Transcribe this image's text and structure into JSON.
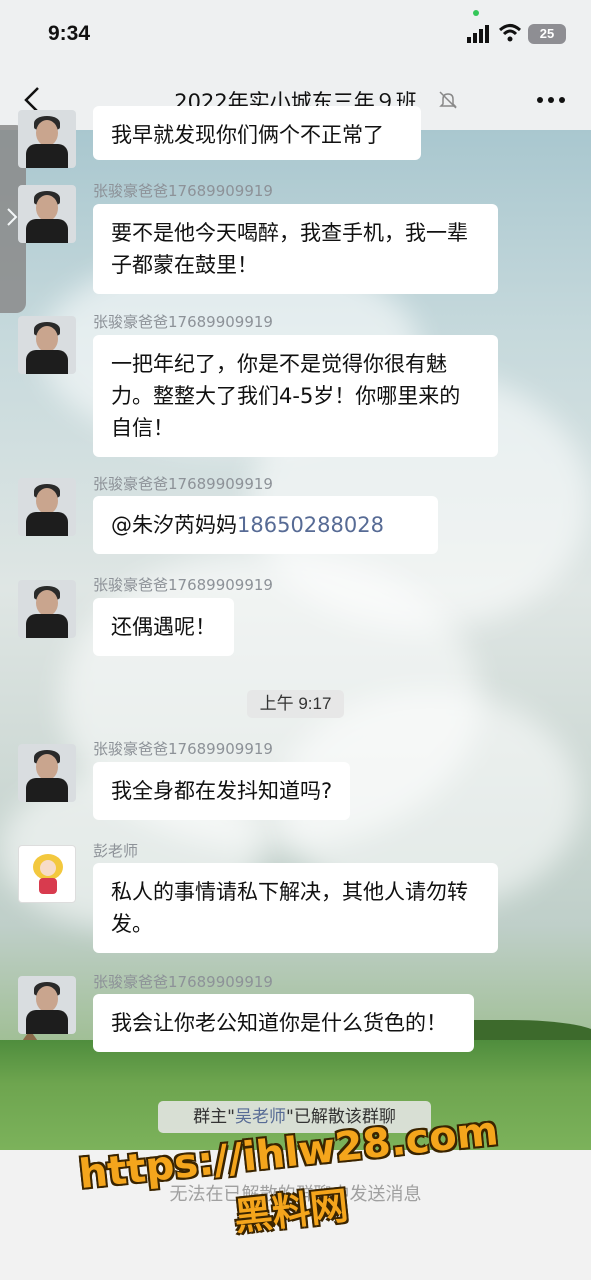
{
  "status_bar": {
    "time": "9:34",
    "battery": "25"
  },
  "nav": {
    "title": "2022年实小城东三年９班"
  },
  "messages": [
    {
      "text": "我早就发现你们俩个不正常了"
    },
    {
      "sender": "张骏豪爸爸17689909919",
      "text": "要不是他今天喝醉，我查手机，我一辈子都蒙在鼓里！"
    },
    {
      "sender": "张骏豪爸爸17689909919",
      "text": "一把年纪了，你是不是觉得你很有魅力。整整大了我们4-5岁！你哪里来的自信！"
    },
    {
      "sender": "张骏豪爸爸17689909919",
      "mention": "@朱汐芮妈妈",
      "phone": "18650288028"
    },
    {
      "sender": "张骏豪爸爸17689909919",
      "text": "还偶遇呢！"
    },
    {
      "sender": "张骏豪爸爸17689909919",
      "text": "我全身都在发抖知道吗?"
    },
    {
      "sender": "彭老师",
      "text": "私人的事情请私下解决，其他人请勿转发。"
    },
    {
      "sender": "张骏豪爸爸17689909919",
      "text": "我会让你老公知道你是什么货色的！"
    }
  ],
  "time_divider": "上午 9:17",
  "system_notice": {
    "prefix": "群主\"",
    "owner": "吴老师",
    "suffix": "\"已解散该群聊"
  },
  "input_placeholder": "无法在已解散的群聊中发送消息",
  "watermark": {
    "url": "https://ihlw28.com",
    "name": "黑料网"
  },
  "colors": {
    "link": "#576b95",
    "watermark": "#f4a51c"
  }
}
